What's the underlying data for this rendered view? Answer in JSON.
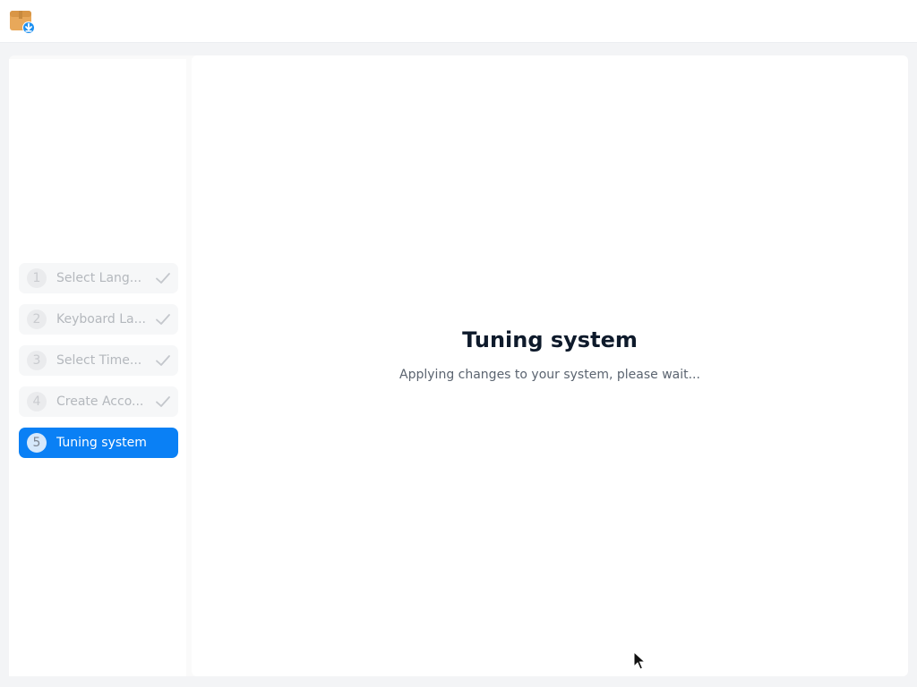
{
  "app": {
    "icon": "package-install-icon"
  },
  "steps": [
    {
      "number": "1",
      "label": "Select Lang...",
      "status": "done"
    },
    {
      "number": "2",
      "label": "Keyboard La...",
      "status": "done"
    },
    {
      "number": "3",
      "label": "Select Time...",
      "status": "done"
    },
    {
      "number": "4",
      "label": "Create Acco...",
      "status": "done"
    },
    {
      "number": "5",
      "label": "Tuning system",
      "status": "active"
    }
  ],
  "main": {
    "title": "Tuning system",
    "subtitle": "Applying changes to your system, please wait..."
  },
  "colors": {
    "accent": "#0a80f5",
    "title": "#0e1a2b",
    "inactive_text": "#b4b8bd"
  }
}
